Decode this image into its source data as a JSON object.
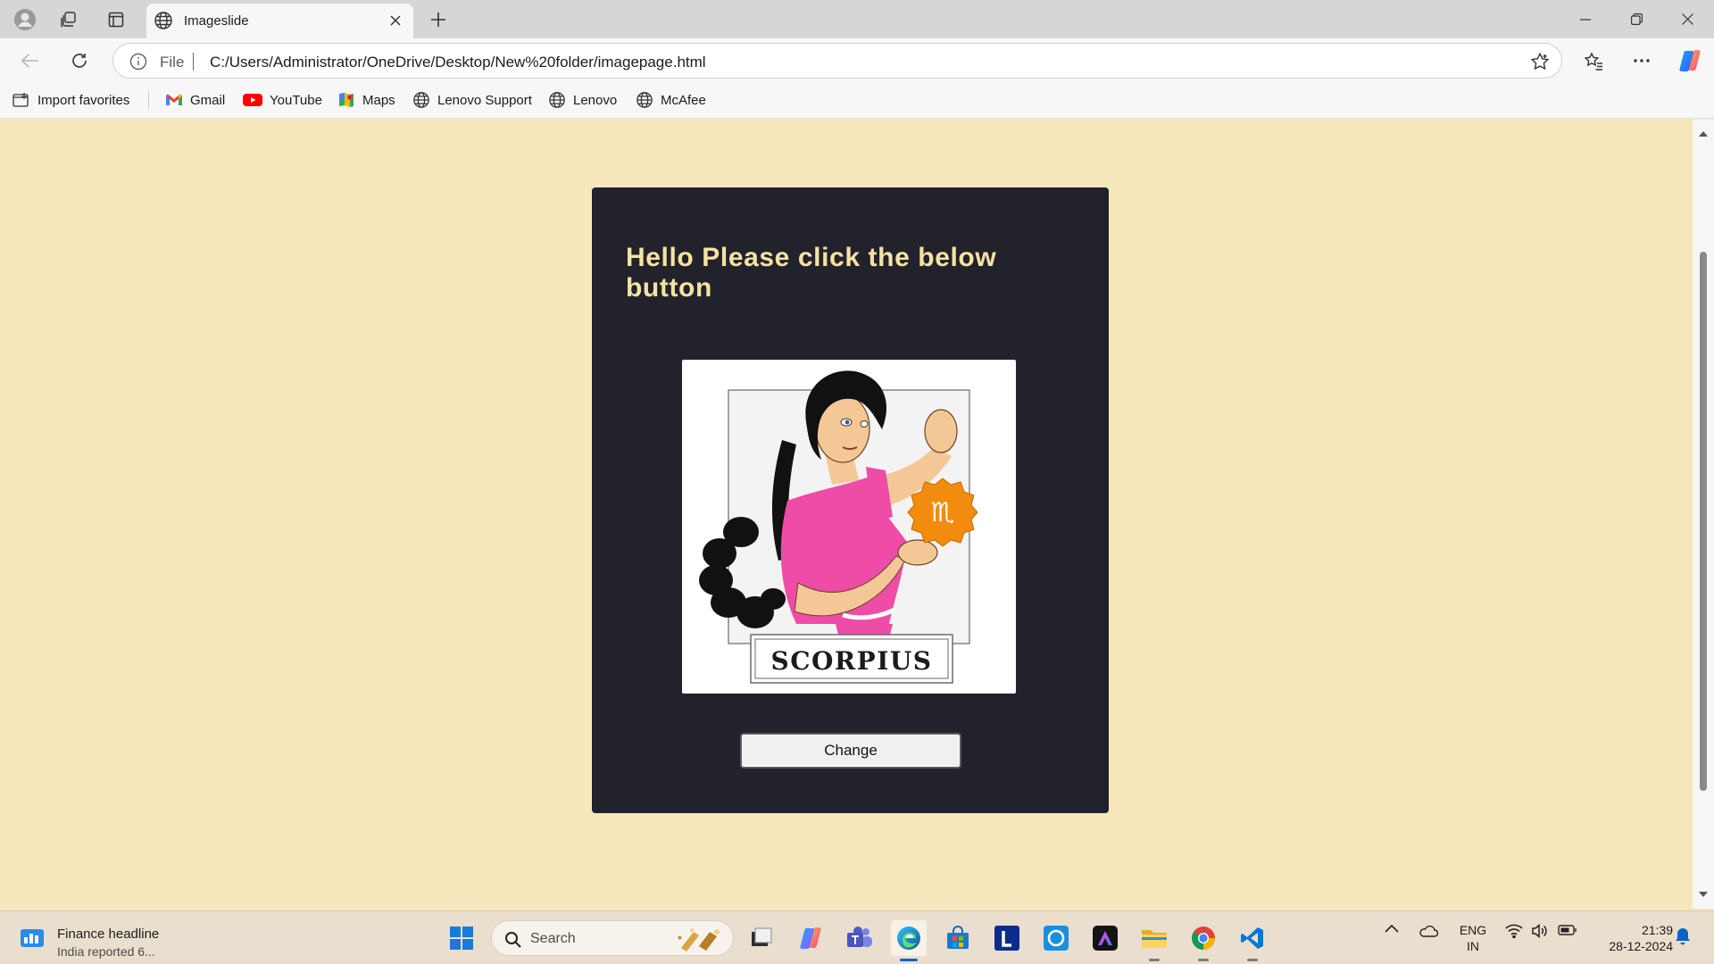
{
  "browser": {
    "tab_title": "Imageslide",
    "address_scheme": "File",
    "address_url": "C:/Users/Administrator/OneDrive/Desktop/New%20folder/imagepage.html"
  },
  "favorites": [
    {
      "label": "Import favorites",
      "icon": "import-icon"
    },
    {
      "label": "Gmail",
      "icon": "gmail-icon"
    },
    {
      "label": "YouTube",
      "icon": "youtube-icon"
    },
    {
      "label": "Maps",
      "icon": "maps-icon"
    },
    {
      "label": "Lenovo Support",
      "icon": "globe-icon"
    },
    {
      "label": "Lenovo",
      "icon": "globe-icon"
    },
    {
      "label": "McAfee",
      "icon": "globe-icon"
    }
  ],
  "page": {
    "heading": "Hello Please click the below button",
    "image_caption": "SCORPIUS",
    "button_label": "Change",
    "colors": {
      "page_background": "#f6e7bd",
      "card_background": "#22222c",
      "heading": "#f6e2a2"
    }
  },
  "taskbar": {
    "news_title": "Finance headline",
    "news_subtitle": "India reported 6...",
    "search_placeholder": "Search",
    "language_line1": "ENG",
    "language_line2": "IN",
    "time": "21:39",
    "date": "28-12-2024"
  }
}
